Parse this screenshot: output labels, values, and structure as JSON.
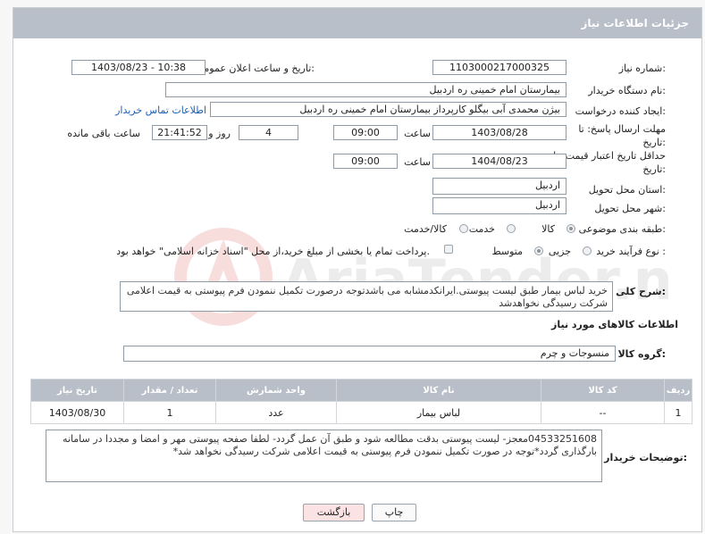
{
  "header": {
    "title": "جزئیات اطلاعات نیاز"
  },
  "fields": {
    "need_number_label": "شماره نیاز:",
    "need_number": "1103000217000325",
    "announce_label": "تاریخ و ساعت اعلان عمومی:",
    "announce_value": "1403/08/23 - 10:38",
    "buyer_org_label": "نام دستگاه خریدار:",
    "buyer_org": "بیمارستان امام خمینی  ره  اردبیل",
    "requester_label": "ایجاد کننده درخواست:",
    "requester": "بیژن محمدی آبی بیگلو کارپرداز بیمارستان امام خمینی  ره  اردبیل",
    "contact_link": "اطلاعات تماس خریدار",
    "deadline_label": "مهلت ارسال پاسخ: تا تاریخ:",
    "deadline_date": "1403/08/28",
    "time_label": "ساعت",
    "deadline_time": "09:00",
    "days_value": "4",
    "days_label": "روز و",
    "remaining_time": "21:41:52",
    "remaining_label": "ساعت باقی مانده",
    "validity_label": "حداقل تاریخ اعتبار قیمت: تا تاریخ:",
    "validity_date": "1404/08/23",
    "validity_time": "09:00",
    "province_label": "استان محل تحویل:",
    "province": "اردبیل",
    "city_label": "شهر محل تحویل:",
    "city": "اردبیل",
    "category_label": "طبقه بندی موضوعی:",
    "category_options": [
      "کالا",
      "خدمت",
      "کالا/خدمت"
    ],
    "process_label": "نوع فرآیند خرید :",
    "process_options": [
      "جزیی",
      "متوسط"
    ],
    "process_note": "پرداخت تمام یا بخشی از مبلغ خرید،از محل \"اسناد خزانه اسلامی\" خواهد بود."
  },
  "description": {
    "label": "شرح کلی نیاز:",
    "text": "خرید لباس بیمار طبق لیست پیوستی.ایرانکدمشابه می باشدتوجه درصورت تکمیل ننمودن فرم پیوستی به قیمت اعلامی شرکت رسیدگی نخواهدشد"
  },
  "goods_section": {
    "title": "اطلاعات کالاهای مورد نیاز",
    "group_label": "گروه کالا:",
    "group_value": "منسوجات و چرم"
  },
  "table": {
    "headers": [
      "ردیف",
      "کد کالا",
      "نام کالا",
      "واحد شمارش",
      "تعداد / مقدار",
      "تاریخ نیاز"
    ],
    "rows": [
      [
        "1",
        "--",
        "لباس بیمار",
        "عدد",
        "1",
        "1403/08/30"
      ]
    ]
  },
  "buyer_notes": {
    "label": "توضیحات خریدار:",
    "text": "04533251608معجز- لیست پیوستی بدقت مطالعه شود و طبق آن عمل گردد- لطفا صفحه پیوستی مهر و امضا و مجددا در سامانه بارگذاری گردد*توجه در صورت تکمیل ننمودن فرم پیوستی به قیمت اعلامی شرکت رسیدگی نخواهد شد*"
  },
  "buttons": {
    "print": "چاپ",
    "back": "بازگشت"
  },
  "colors": {
    "header_bg": "#b9bfc8",
    "link": "#1c5fb5",
    "back_btn_bg": "#fbe3e3"
  },
  "watermark": {
    "text": "AriaTender.neT"
  }
}
